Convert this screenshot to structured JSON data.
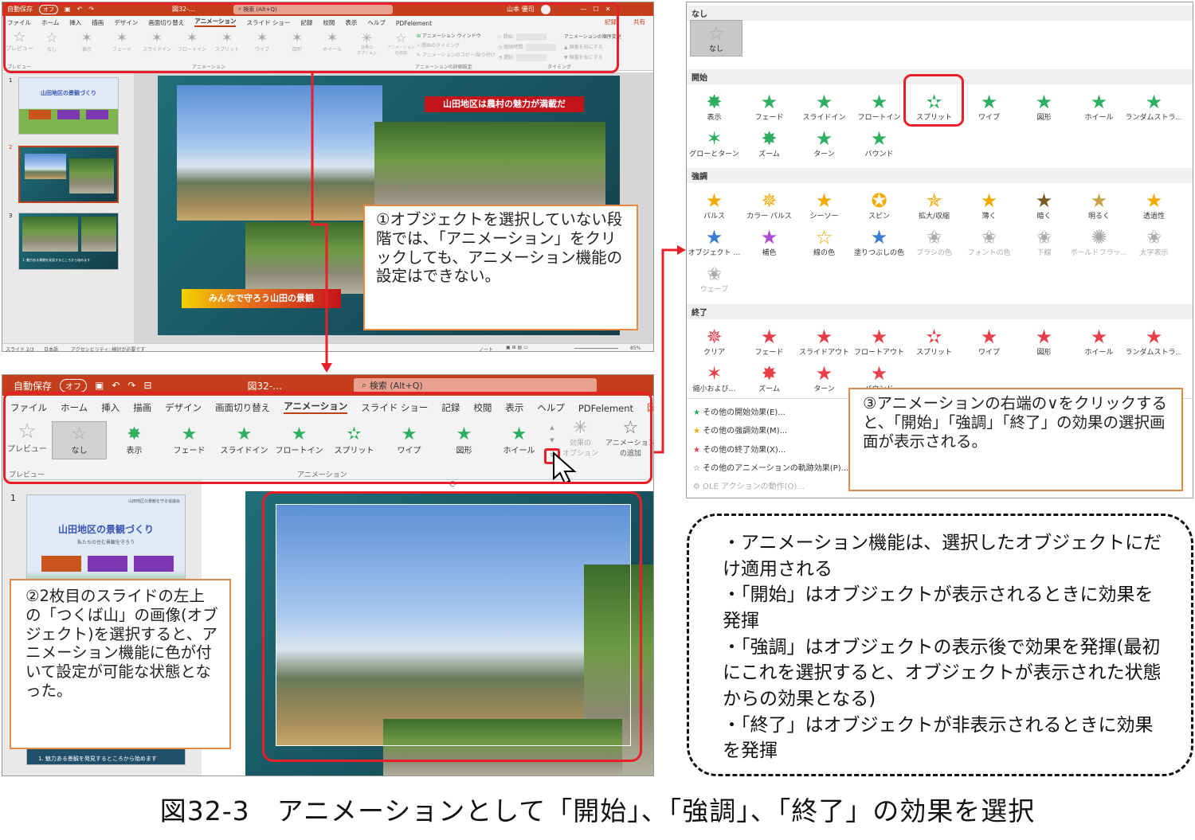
{
  "top_window": {
    "autosave": "自動保存",
    "autosave_state": "オフ",
    "doc_name": "図32-…",
    "search": "検索 (Alt+Q)",
    "user": "山本 優司",
    "tabs": [
      "ファイル",
      "ホーム",
      "挿入",
      "描画",
      "デザイン",
      "画面切り替え",
      "アニメーション",
      "スライド ショー",
      "記録",
      "校閲",
      "表示",
      "ヘルプ",
      "PDFelement"
    ],
    "record_btn": "記録",
    "share_btn": "共有",
    "preview": "プレビュー",
    "effects": [
      "なし",
      "表示",
      "フェード",
      "スライドイン",
      "フロートイン",
      "スプリット",
      "ワイプ",
      "図形",
      "ホイール"
    ],
    "effect_options": "効果の\nオプション",
    "add_animation": "アニメーション\nの追加",
    "pane": "アニメーション ウィンドウ",
    "trigger": "開始のタイミング",
    "painter": "アニメーションのコピー/貼り付け",
    "start_label": "開始:",
    "duration_label": "継続時間:",
    "delay_label": "遅延:",
    "reorder": "アニメーションの順序変更",
    "move_earlier": "順番を前にする",
    "move_later": "順番を後にする",
    "group_preview": "プレビュー",
    "group_animation": "アニメーション",
    "group_advanced": "アニメーションの詳細設定",
    "group_timing": "タイミング",
    "slide_numbers": [
      "1",
      "2",
      "3"
    ],
    "thumb1_title": "山田地区の景観づくり",
    "thumb3_text": "1. 魅力ある景観を発見するところから始めます",
    "slide_banner1": "山田地区は農村の魅力が満載だ",
    "slide_banner2": "みんなで守ろう山田の景観",
    "status_slide": "スライド 2/3",
    "status_lang": "日本語",
    "status_access": "アクセシビリティ: 検討が必要です",
    "status_notes": "ノート",
    "status_zoom": "85%"
  },
  "bottom_window": {
    "autosave": "自動保存",
    "autosave_state": "オフ",
    "doc_name": "図32-…",
    "search": "検索 (Alt+Q)",
    "tabs": [
      "ファイル",
      "ホーム",
      "挿入",
      "描画",
      "デザイン",
      "画面切り替え",
      "アニメーション",
      "スライド ショー",
      "記録",
      "校閲",
      "表示",
      "ヘルプ",
      "PDFelement",
      "図の形式"
    ],
    "preview": "プレビュー",
    "effects": [
      "なし",
      "表示",
      "フェード",
      "スライドイン",
      "フロートイン",
      "スプリット",
      "ワイプ",
      "図形",
      "ホイール"
    ],
    "effect_options": "効果の\nオプション",
    "add_animation": "アニメーション\nの追加",
    "group_preview": "プレビュー",
    "group_animation": "アニメーション",
    "slide_number": "1",
    "thumb1_title": "山田地区の景観づくり",
    "thumb1_small": "山田地区の景観を守る協議会",
    "thumb1_sub": "私たちの住む景観を守ろう",
    "thumb_bottom_text": "1. 魅力ある景観を発見するところから始めます"
  },
  "gallery": {
    "none_header": "なし",
    "none_item": "なし",
    "start_header": "開始",
    "start_items": [
      "表示",
      "フェード",
      "スライドイン",
      "フロートイン",
      "スプリット",
      "ワイプ",
      "図形",
      "ホイール",
      "ランダムストラ…",
      "グローとターン",
      "ズーム",
      "ターン",
      "バウンド"
    ],
    "emphasis_header": "強調",
    "emphasis_items": [
      "パルス",
      "カラー パルス",
      "シーソー",
      "スピン",
      "拡大/収縮",
      "薄く",
      "暗く",
      "明るく",
      "透過性",
      "オブジェクト …",
      "補色",
      "線の色",
      "塗りつぶしの色",
      "ブラシの色",
      "フォントの色",
      "下線",
      "ボールドフラッ…",
      "太字表示",
      "ウェーブ"
    ],
    "exit_header": "終了",
    "exit_items": [
      "クリア",
      "フェード",
      "スライドアウト",
      "フロートアウト",
      "スプリット",
      "ワイプ",
      "図形",
      "ホイール",
      "ランダムストラ…",
      "縮小および…",
      "ズーム",
      "ターン",
      "バウンド"
    ],
    "more_start": "その他の開始効果(E)...",
    "more_emphasis": "その他の強調効果(M)...",
    "more_exit": "その他の終了効果(X)...",
    "more_path": "その他のアニメーションの軌跡効果(P)...",
    "ole": "OLE アクションの動作(O)..."
  },
  "notes": {
    "note1": "①オブジェクトを選択していない段階では、「アニメーション」をクリックしても、アニメーション機能の設定はできない。",
    "note2": "②2枚目のスライドの左上の「つくば山」の画像(オブジェクト)を選択すると、アニメーション機能に色が付いて設定が可能な状態となった。",
    "note3": "③アニメーションの右端の∨をクリックすると、「開始」「強調」「終了」の効果の選択画面が表示される。",
    "bullets": [
      "・アニメーション機能は、選択したオブジェクトにだけ適用される",
      "・「開始」はオブジェクトが表示されるときに効果を発揮",
      "・「強調」はオブジェクトの表示後で効果を発揮(最初にこれを選択すると、オブジェクトが表示された状態からの効果となる)",
      "・「終了」はオブジェクトが非表示されるときに効果を発揮"
    ]
  },
  "caption": "図32-3　アニメーションとして「開始」、「強調」、「終了」の効果を選択",
  "colors": {
    "accent": "#c43e1c",
    "highlight": "#e81e28",
    "note_border": "#e48a45",
    "start": "#2eae61",
    "emphasis": "#f2a900",
    "exit": "#e8404a"
  }
}
